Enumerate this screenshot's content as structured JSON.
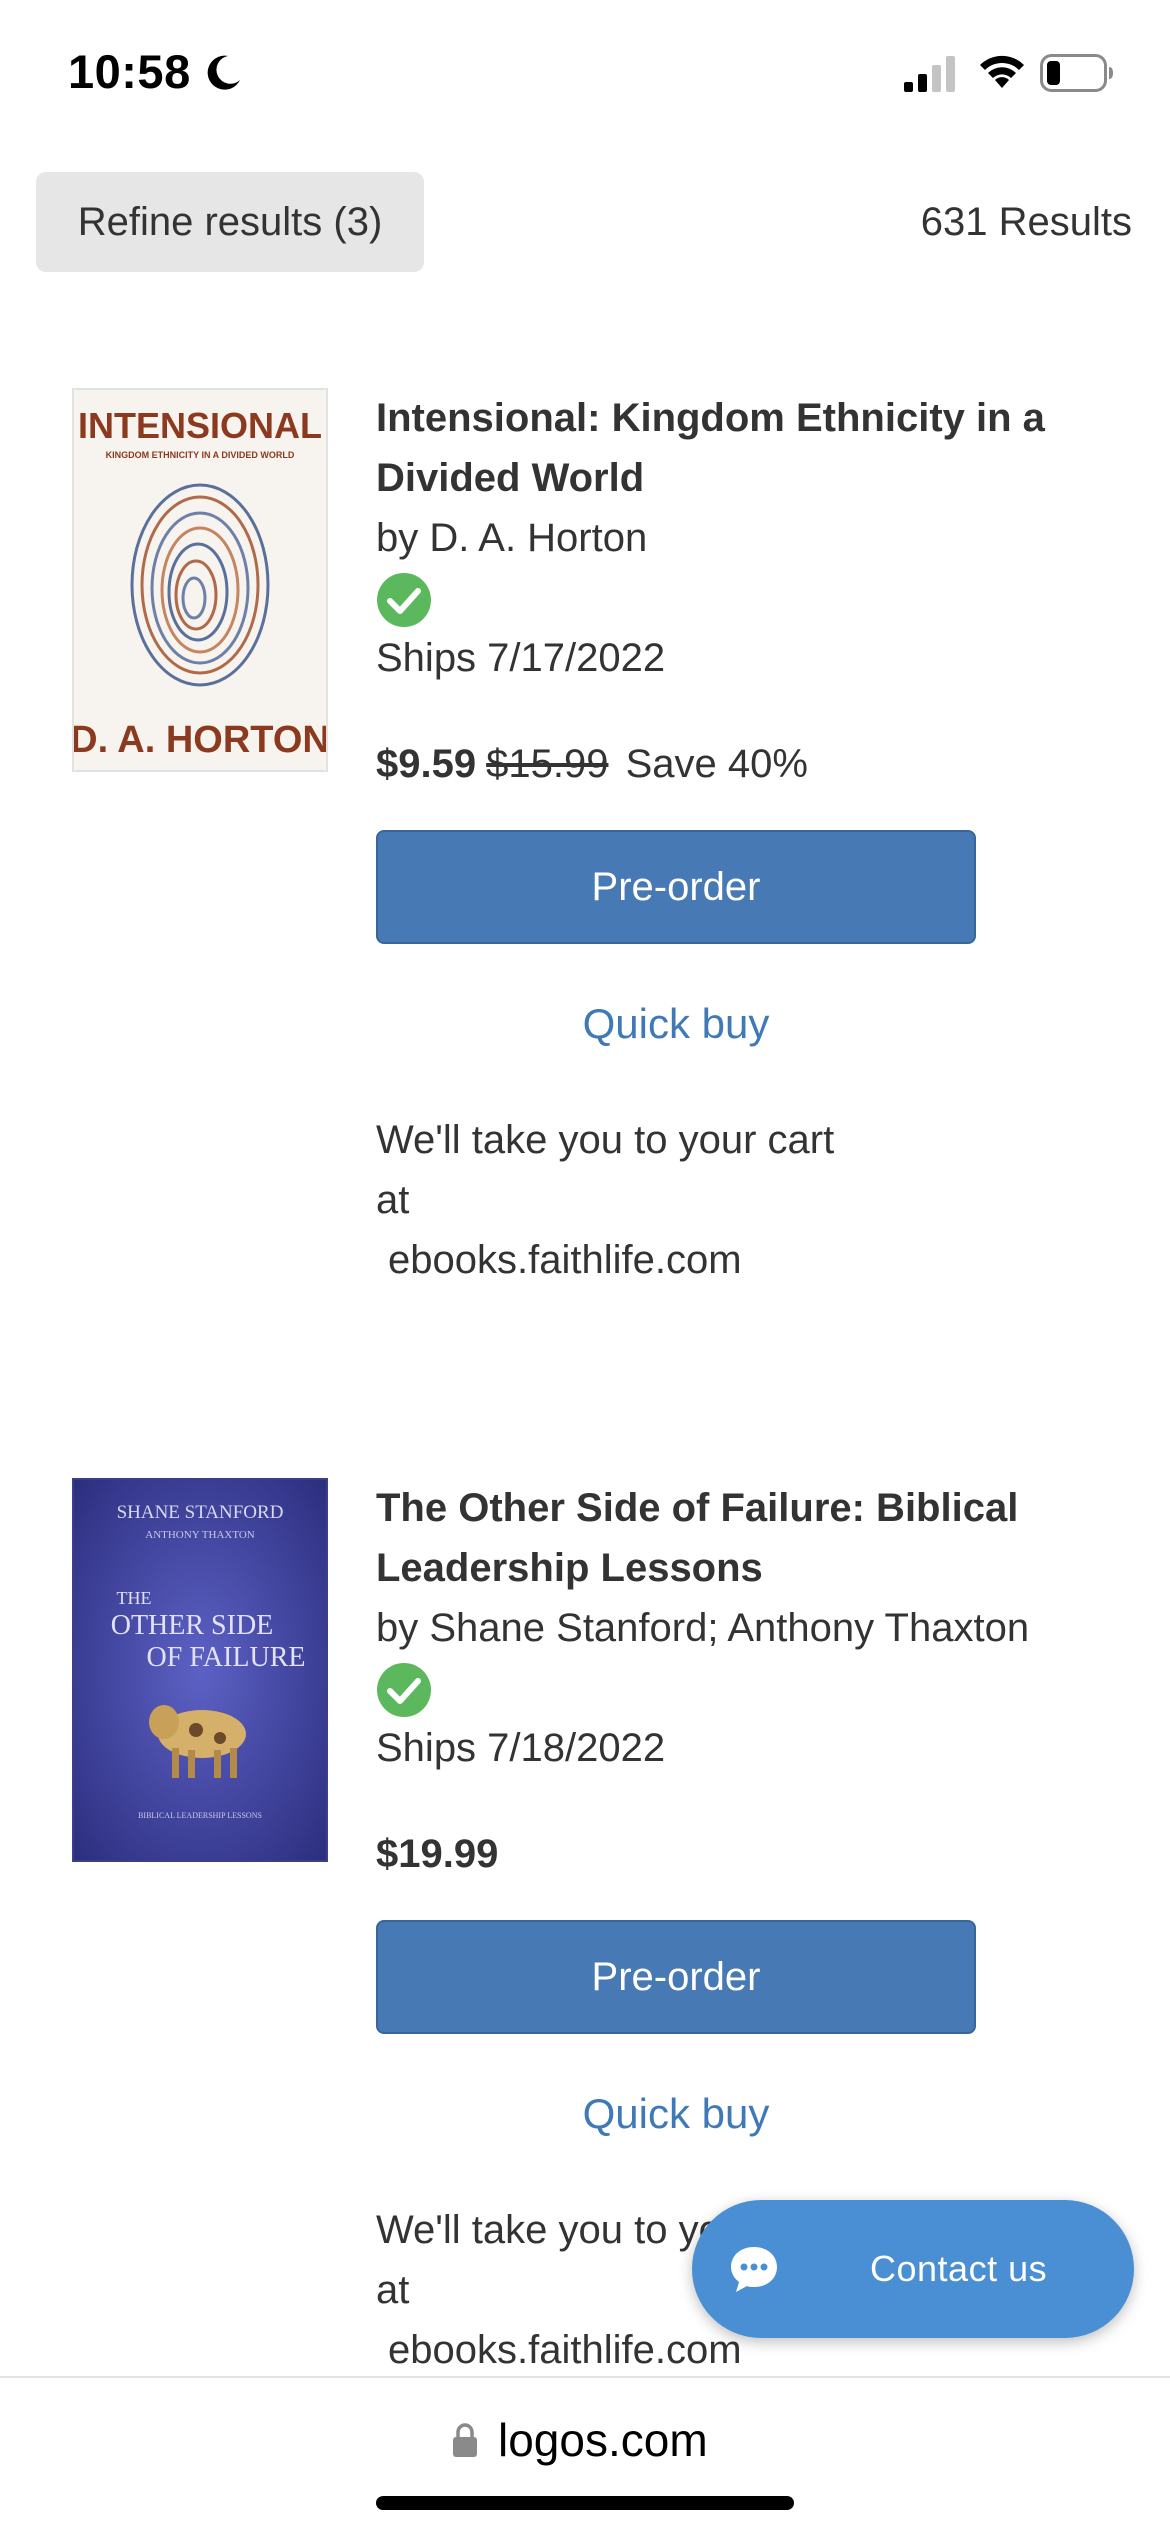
{
  "status_bar": {
    "time": "10:58",
    "icons": [
      "moon-icon",
      "signal-icon",
      "wifi-icon",
      "battery-icon"
    ]
  },
  "refine": {
    "label": "Refine results (3)",
    "results": "631 Results"
  },
  "products": [
    {
      "cover_title": "INTENSIONAL",
      "cover_subtitle": "KINGDOM ETHNICITY IN A DIVIDED WORLD",
      "cover_author": "D. A. HORTON",
      "title": "Intensional: Kingdom Ethnicity in a Divided World",
      "author": "by D. A. Horton",
      "ships": "Ships 7/17/2022",
      "price": "$9.59",
      "old_price": "$15.99",
      "save": "Save 40%",
      "preorder_label": "Pre-order",
      "quickbuy_label": "Quick buy",
      "note_line1": "We'll take you to your cart",
      "note_line2": "at",
      "note_url": "ebooks.faithlife.com"
    },
    {
      "cover_authors": "SHANE STANFORD",
      "cover_authors2": "ANTHONY THAXTON",
      "cover_title1": "THE",
      "cover_title2": "OTHER SIDE",
      "cover_title3": "OF FAILURE",
      "cover_subtitle": "BIBLICAL LEADERSHIP LESSONS",
      "title": "The Other Side of Failure: Biblical Leadership Lessons",
      "author": "by Shane Stanford; Anthony Thaxton",
      "ships": "Ships 7/18/2022",
      "price": "$19.99",
      "preorder_label": "Pre-order",
      "quickbuy_label": "Quick buy",
      "note_line1": "We'll take you to your cart",
      "note_line2": "at",
      "note_url": "ebooks.faithlife.com"
    }
  ],
  "contact": {
    "label": "Contact us"
  },
  "url_bar": {
    "url": "logos.com"
  },
  "colors": {
    "button_blue": "#4779b4",
    "link_blue": "#3f79b8",
    "contact_blue": "#4a8fd4",
    "check_green": "#5cb85c"
  }
}
